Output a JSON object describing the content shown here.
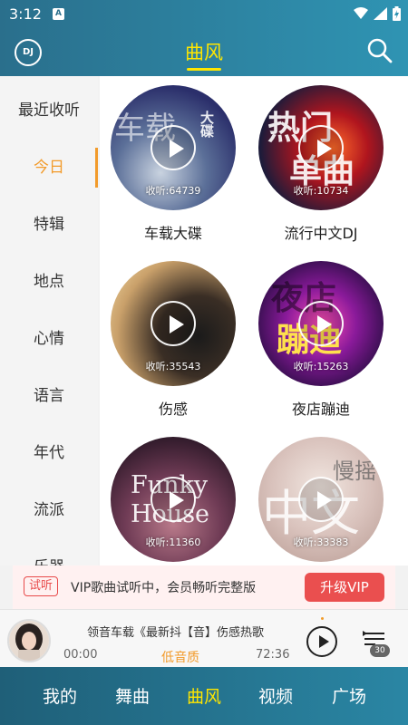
{
  "status": {
    "time": "3:12",
    "notif_icon": "A"
  },
  "header": {
    "logo_text": "DJ",
    "title": "曲风"
  },
  "sidebar": {
    "items": [
      {
        "label": "最近收听"
      },
      {
        "label": "今日",
        "active": true
      },
      {
        "label": "特辑"
      },
      {
        "label": "地点"
      },
      {
        "label": "心情"
      },
      {
        "label": "语言"
      },
      {
        "label": "年代"
      },
      {
        "label": "流派"
      },
      {
        "label": "乐器"
      }
    ]
  },
  "cards": [
    {
      "name": "车载大碟",
      "count": "收听:64739",
      "art_text": "车载",
      "art_text2": "大碟"
    },
    {
      "name": "流行中文DJ",
      "count": "收听:10734",
      "art_text": "热门",
      "art_text2": "单曲"
    },
    {
      "name": "伤感",
      "count": "收听:35543"
    },
    {
      "name": "夜店蹦迪",
      "count": "收听:15263",
      "art_text": "夜店",
      "art_text2": "蹦迪"
    },
    {
      "name": "",
      "count": "收听:11360",
      "art_text": "Funky",
      "art_text2": "House"
    },
    {
      "name": "",
      "count": "收听:33383",
      "art_text": "中文",
      "art_text2": "慢摇"
    }
  ],
  "vip": {
    "tag": "试听",
    "message": "VIP歌曲试听中，会员畅听完整版",
    "button": "升级VIP"
  },
  "player": {
    "song": "领音车载《最新抖【音】伤感热歌",
    "current_time": "00:00",
    "quality": "低音质",
    "total_time": "72:36",
    "queue_count": "30"
  },
  "bottom_nav": [
    {
      "label": "我的"
    },
    {
      "label": "舞曲"
    },
    {
      "label": "曲风",
      "active": true
    },
    {
      "label": "视频"
    },
    {
      "label": "广场"
    }
  ],
  "colors": {
    "accent": "#f29b2b",
    "header_title": "#ffe600",
    "vip_red": "#ea4f4f"
  }
}
